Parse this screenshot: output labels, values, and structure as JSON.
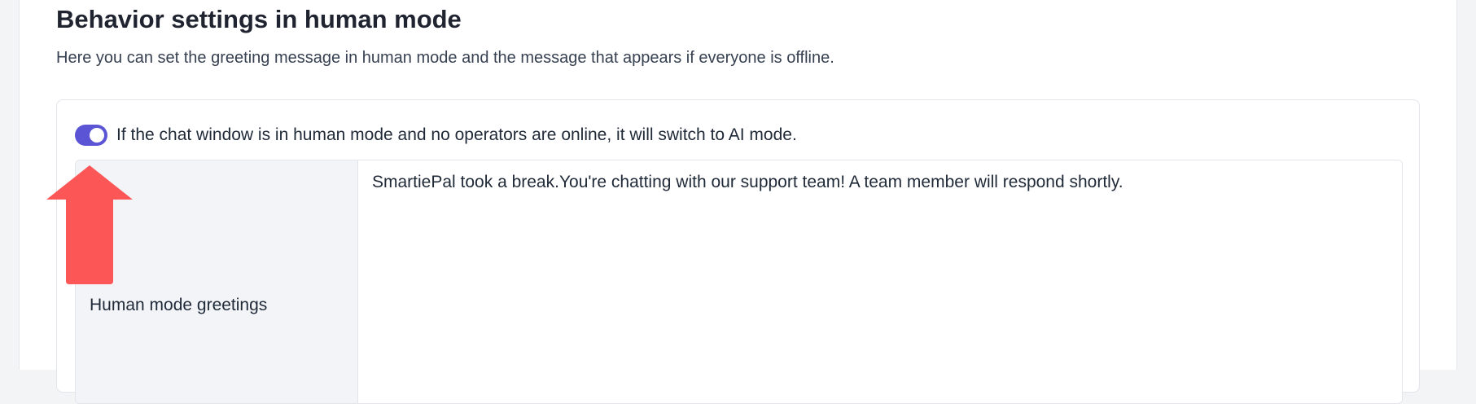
{
  "section": {
    "title": "Behavior settings in human mode",
    "description": "Here you can set the greeting message in human mode and the message that appears if everyone is offline."
  },
  "settings": {
    "ai_fallback_toggle": {
      "enabled": true,
      "label": "If the chat window is in human mode and no operators are online, it will switch to AI mode."
    },
    "greetings": {
      "label": "Human mode greetings",
      "value": "SmartiePal took a break.You're chatting with our support team! A team member will respond shortly."
    }
  },
  "annotation": {
    "arrow_color": "#fc5656",
    "arrow_direction": "up"
  },
  "colors": {
    "accent": "#5b55d6",
    "label_cell_bg": "#f3f4f8"
  }
}
